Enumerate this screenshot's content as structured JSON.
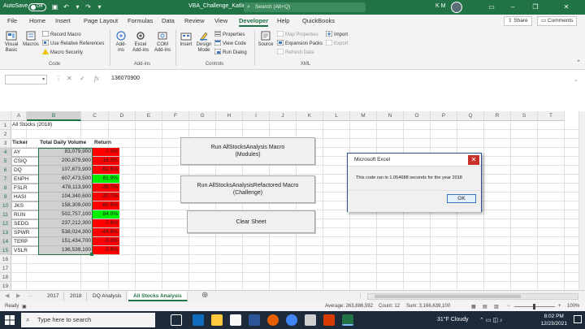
{
  "titlebar": {
    "autosave_label": "AutoSave",
    "autosave_state": "Off",
    "file_name": "VBA_Challenge_Katlin.xlsm",
    "saved_dropdown": "▾",
    "search_placeholder": "Search (Alt+Q)",
    "user_initials": "K M"
  },
  "menu": {
    "tabs": [
      "File",
      "Home",
      "Insert",
      "Page Layout",
      "Formulas",
      "Data",
      "Review",
      "View",
      "Developer",
      "Help",
      "QuickBooks"
    ],
    "active_tab": "Developer",
    "share_label": "Share",
    "comments_label": "Comments"
  },
  "ribbon": {
    "code": {
      "visual_basic": "Visual Basic",
      "macros": "Macros",
      "record_macro": "Record Macro",
      "use_relative": "Use Relative References",
      "macro_security": "Macro Security",
      "label": "Code"
    },
    "addins": {
      "add_ins": "Add-ins",
      "excel_addins": "Excel Add-ins",
      "com_addins": "COM Add-ins",
      "label": "Add-ins"
    },
    "controls": {
      "insert": "Insert",
      "design_mode": "Design Mode",
      "properties": "Properties",
      "view_code": "View Code",
      "run_dialog": "Run Dialog",
      "label": "Controls"
    },
    "xml": {
      "source": "Source",
      "map_properties": "Map Properties",
      "expansion_packs": "Expansion Packs",
      "refresh_data": "Refresh Data",
      "import": "Import",
      "export": "Export",
      "label": "XML"
    }
  },
  "formula_bar": {
    "name_box": "",
    "fx_label": "fx",
    "value": "136070900"
  },
  "grid": {
    "columns": [
      "A",
      "B",
      "C",
      "D",
      "E",
      "F",
      "G",
      "H",
      "I",
      "J",
      "K",
      "L",
      "M",
      "N",
      "O",
      "P",
      "Q",
      "R",
      "S",
      "T"
    ],
    "rows": [
      "1",
      "2",
      "3",
      "4",
      "5",
      "6",
      "7",
      "8",
      "9",
      "10",
      "11",
      "12",
      "13",
      "14",
      "15",
      "16",
      "17",
      "18",
      "19",
      "20"
    ],
    "title": "All Stocks (2018)",
    "headers": {
      "ticker": "Ticker",
      "volume": "Total Daily Volume",
      "return": "Return"
    },
    "data": [
      {
        "ticker": "AY",
        "volume": "83,079,900",
        "return": "-7.3%",
        "color": "#ff0000"
      },
      {
        "ticker": "CSIQ",
        "volume": "200,879,900",
        "return": "-16.3%",
        "color": "#ff0000"
      },
      {
        "ticker": "DQ",
        "volume": "107,873,900",
        "return": "-62.6%",
        "color": "#ff0000"
      },
      {
        "ticker": "ENPH",
        "volume": "607,473,500",
        "return": "81.9%",
        "color": "#00ee00"
      },
      {
        "ticker": "FSLR",
        "volume": "478,113,900",
        "return": "-39.7%",
        "color": "#ff0000"
      },
      {
        "ticker": "HASI",
        "volume": "104,340,600",
        "return": "-20.7%",
        "color": "#ff0000"
      },
      {
        "ticker": "JKS",
        "volume": "158,309,000",
        "return": "-60.5%",
        "color": "#ff0000"
      },
      {
        "ticker": "RUN",
        "volume": "502,757,100",
        "return": "84.0%",
        "color": "#00ee00"
      },
      {
        "ticker": "SEDG",
        "volume": "237,212,300",
        "return": "-7.8%",
        "color": "#ff0000"
      },
      {
        "ticker": "SPWR",
        "volume": "538,024,300",
        "return": "-44.6%",
        "color": "#ff0000"
      },
      {
        "ticker": "TERP",
        "volume": "151,434,700",
        "return": "-5.0%",
        "color": "#ff0000"
      },
      {
        "ticker": "VSLR",
        "volume": "136,539,100",
        "return": "-3.5%",
        "color": "#ff0000"
      }
    ]
  },
  "macro_buttons": {
    "modules": "Run AllStocksAnalysis Macro (Modules)",
    "refactored": "Run AllStocksAnalysisRefactored Macro (Challenge)",
    "clear": "Clear Sheet"
  },
  "dialog": {
    "title": "Microsoft Excel",
    "message": "This code ran in 1.054688 seconds for the year 2018",
    "ok_label": "OK"
  },
  "sheet_tabs": {
    "tabs": [
      "2017",
      "2018",
      "DQ Analysis",
      "All Stocks Analysis"
    ],
    "active": "All Stocks Analysis",
    "ellipsis": "..."
  },
  "status": {
    "mode": "Ready",
    "average": "Average: 263,886,592",
    "count": "Count: 12",
    "sum": "Sum: 3,166,639,100",
    "zoom": "100%"
  },
  "taskbar": {
    "search_placeholder": "Type here to search",
    "weather": "31°F  Cloudy",
    "time": "8:02 PM",
    "date": "12/23/2021"
  },
  "colors": {
    "excel_green": "#217346",
    "return_positive": "#00ee00",
    "return_negative": "#ff0000",
    "dialog_close": "#c8312a"
  }
}
